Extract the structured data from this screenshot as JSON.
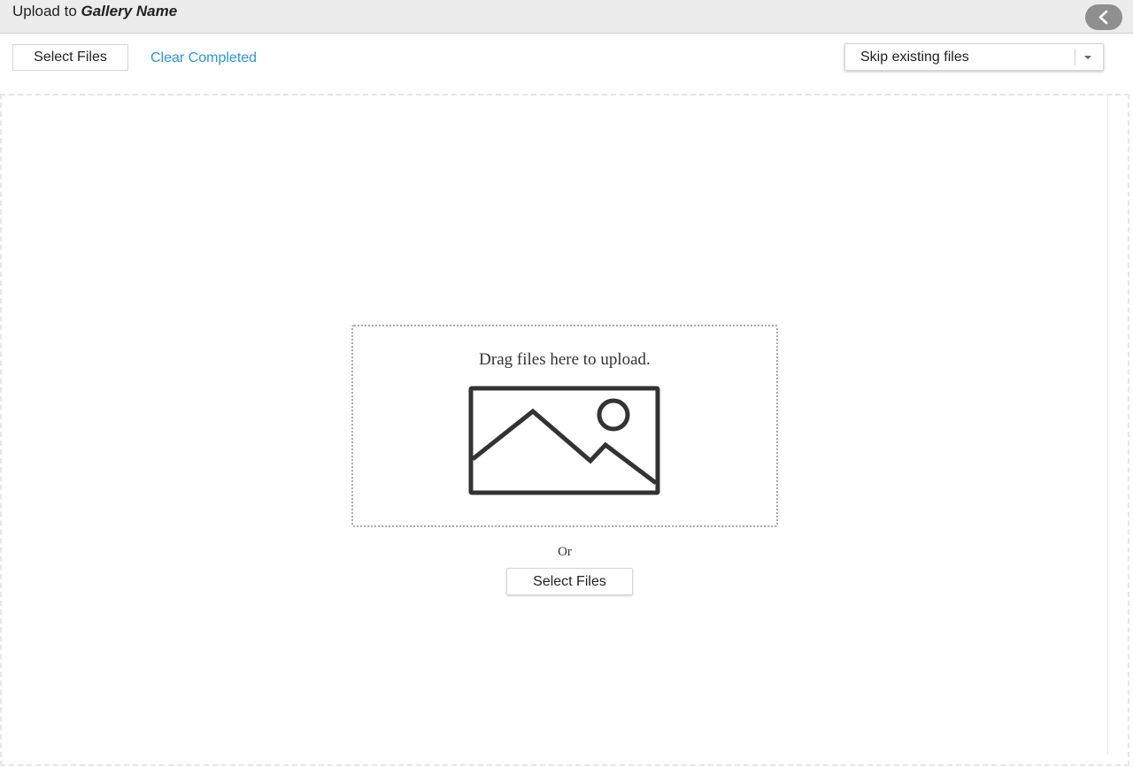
{
  "header": {
    "title_prefix": "Upload to ",
    "gallery_name": "Gallery Name",
    "collapse_icon": "chevron-left-icon"
  },
  "toolbar": {
    "select_files_label": "Select Files",
    "clear_completed_label": "Clear Completed",
    "duplicate_mode": {
      "selected": "Skip existing files"
    }
  },
  "dropzone": {
    "prompt": "Drag files here to upload.",
    "icon": "image-placeholder-icon",
    "or_text": "Or",
    "select_files_label": "Select Files"
  },
  "colors": {
    "link": "#2c96d9",
    "header_bg": "#ececec",
    "collapse_button": "#8f8f8f"
  }
}
